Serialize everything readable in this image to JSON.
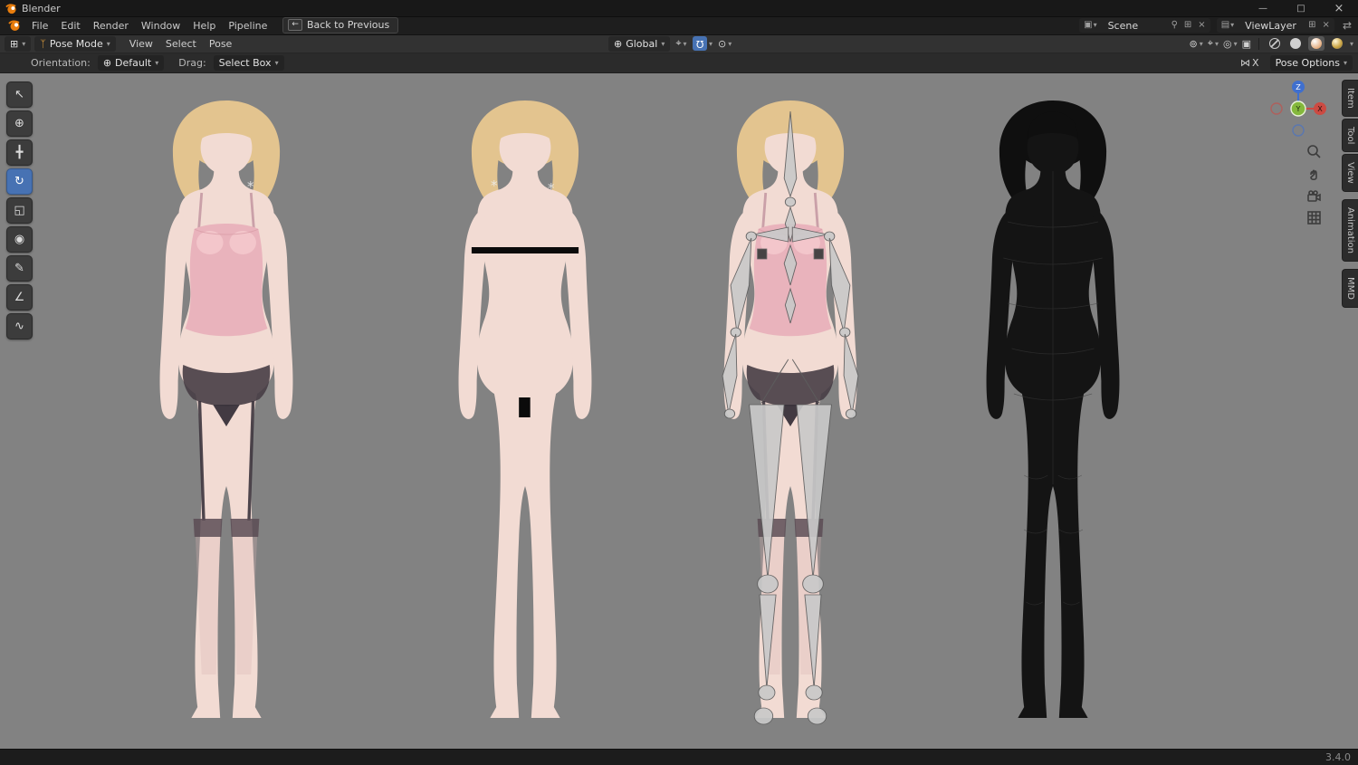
{
  "colors": {
    "accent": "#4772b3",
    "viewport_bg": "#828282",
    "skin": "#f2dbd3",
    "hair_blonde": "#e3c48f",
    "outfit_pink": "#e9b3bc",
    "outfit_dark": "#473d45",
    "bone_gray": "#c9c9c9",
    "wireframe_black": "#141414",
    "axis_x": "#cc4a42",
    "axis_y": "#84b83c",
    "axis_z": "#3f6fce"
  },
  "titlebar": {
    "app_title": "Blender"
  },
  "icons": {
    "minimize": "—",
    "maximize": "□",
    "close": "×",
    "editor_type": "⊞",
    "chevron": "▾",
    "pose_mode": "ᛉ",
    "orientation_globe": "⊕",
    "pivot": "⌖",
    "snap_magnet": "Ω",
    "proportional": "⊙",
    "visibility": "⊚",
    "show_gizmo": "⌖",
    "overlays": "◎",
    "xray": "▣",
    "scene": "▣",
    "viewlayer": "▤",
    "pin": "⚲",
    "new_copy": "⊞",
    "unlink": "×",
    "swap": "⇄",
    "back_key": "←",
    "mirror_bowtie": "⋈",
    "axes": "⊕",
    "sparkle": "*"
  },
  "menubar": {
    "items": [
      "File",
      "Edit",
      "Render",
      "Window",
      "Help",
      "Pipeline"
    ],
    "back_label": "Back to Previous",
    "scene_label": "Scene",
    "viewlayer_label": "ViewLayer"
  },
  "viewport_header": {
    "mode": "Pose Mode",
    "menus": [
      "View",
      "Select",
      "Pose"
    ],
    "orientation": "Global"
  },
  "tool_settings": {
    "orientation_label": "Orientation:",
    "orientation_value": "Default",
    "drag_label": "Drag:",
    "drag_value": "Select Box",
    "mirror_label": "X",
    "pose_options": "Pose Options"
  },
  "tools": {
    "items": [
      {
        "name": "tweak",
        "glyph": "↖"
      },
      {
        "name": "cursor",
        "glyph": "⊕"
      },
      {
        "name": "move",
        "glyph": "╋"
      },
      {
        "name": "rotate",
        "glyph": "↻"
      },
      {
        "name": "scale",
        "glyph": "◱"
      },
      {
        "name": "transform",
        "glyph": "◉"
      },
      {
        "name": "annotate",
        "glyph": "✎"
      },
      {
        "name": "measure",
        "glyph": "∠"
      },
      {
        "name": "breakdowner",
        "glyph": "∿"
      }
    ]
  },
  "gizmo": {
    "x": "X",
    "y": "Y",
    "z": "Z"
  },
  "sidebar_tabs": [
    "Item",
    "Tool",
    "View",
    "Animation",
    "MMD"
  ],
  "status": {
    "version": "3.4.0"
  }
}
